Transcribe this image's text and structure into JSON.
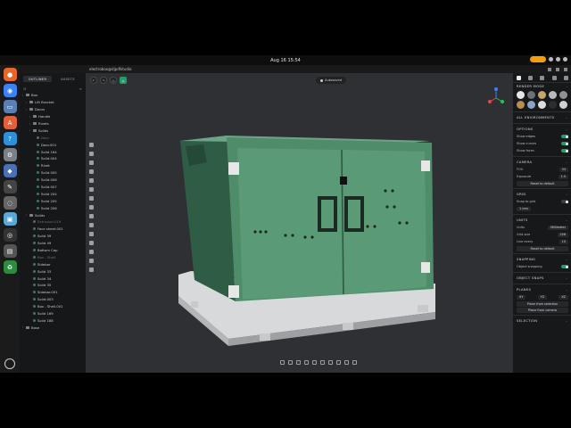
{
  "system": {
    "clock": "Aug 16  15:54"
  },
  "app": {
    "url": "electrobox@djpdfstudio",
    "saved_label": "Autosaved"
  },
  "outliner": {
    "tabs": [
      {
        "label": "OUTLINER"
      },
      {
        "label": "ASSETS"
      }
    ],
    "items": [
      {
        "label": "Box",
        "indent": 0,
        "kind": "folder",
        "dim": false
      },
      {
        "label": "Lift Bracket",
        "indent": 1,
        "kind": "folder",
        "dim": false
      },
      {
        "label": "Doors",
        "indent": 1,
        "kind": "folder",
        "dim": false
      },
      {
        "label": "Handle",
        "indent": 2,
        "kind": "folder",
        "dim": false
      },
      {
        "label": "Rivets",
        "indent": 2,
        "kind": "folder",
        "dim": false
      },
      {
        "label": "Solids",
        "indent": 2,
        "kind": "folder",
        "dim": false
      },
      {
        "label": "Door",
        "indent": 3,
        "kind": "solid",
        "dim": true
      },
      {
        "label": "Door.001",
        "indent": 3,
        "kind": "solid",
        "dim": false
      },
      {
        "label": "Solid 164",
        "indent": 3,
        "kind": "solid",
        "dim": false
      },
      {
        "label": "Solid.004",
        "indent": 3,
        "kind": "solid",
        "dim": false
      },
      {
        "label": "Rivet",
        "indent": 3,
        "kind": "solid",
        "dim": false
      },
      {
        "label": "Solid.005",
        "indent": 3,
        "kind": "solid",
        "dim": false
      },
      {
        "label": "Solid.006",
        "indent": 3,
        "kind": "solid",
        "dim": false
      },
      {
        "label": "Solid.007",
        "indent": 3,
        "kind": "solid",
        "dim": false
      },
      {
        "label": "Solid 204",
        "indent": 3,
        "kind": "solid",
        "dim": false
      },
      {
        "label": "Solid 205",
        "indent": 3,
        "kind": "solid",
        "dim": false
      },
      {
        "label": "Solid 206",
        "indent": 3,
        "kind": "solid",
        "dim": false
      },
      {
        "label": "Solids",
        "indent": 1,
        "kind": "folder",
        "dim": false
      },
      {
        "label": "Extrusion.019",
        "indent": 2,
        "kind": "solid",
        "dim": true
      },
      {
        "label": "Face sheet.001",
        "indent": 2,
        "kind": "solid",
        "dim": false
      },
      {
        "label": "Solid 39",
        "indent": 2,
        "kind": "solid",
        "dim": false
      },
      {
        "label": "Solid 49",
        "indent": 2,
        "kind": "solid",
        "dim": false
      },
      {
        "label": "Bottom Cap",
        "indent": 2,
        "kind": "solid",
        "dim": false
      },
      {
        "label": "Box - Shell",
        "indent": 2,
        "kind": "solid",
        "dim": true
      },
      {
        "label": "Sidebar",
        "indent": 2,
        "kind": "solid",
        "dim": false
      },
      {
        "label": "Solid 33",
        "indent": 2,
        "kind": "solid",
        "dim": false
      },
      {
        "label": "Solid 34",
        "indent": 2,
        "kind": "solid",
        "dim": false
      },
      {
        "label": "Solid 35",
        "indent": 2,
        "kind": "solid",
        "dim": false
      },
      {
        "label": "Sidebar.001",
        "indent": 2,
        "kind": "solid",
        "dim": false
      },
      {
        "label": "Solid.003",
        "indent": 2,
        "kind": "solid",
        "dim": false
      },
      {
        "label": "Box - Shell.001",
        "indent": 2,
        "kind": "solid",
        "dim": false
      },
      {
        "label": "Solid 169",
        "indent": 2,
        "kind": "solid",
        "dim": false
      },
      {
        "label": "Solid 188",
        "indent": 2,
        "kind": "solid",
        "dim": false
      },
      {
        "label": "Base",
        "indent": 0,
        "kind": "folder",
        "dim": false
      }
    ]
  },
  "panel": {
    "render_mode": "RENDER MODE",
    "all_environments": "ALL ENVIRONMENTS",
    "options": "OPTIONS",
    "show_edges": "Show edges",
    "show_curves": "Show curves",
    "show_faces": "Show faces",
    "camera": "CAMERA",
    "fov_label": "FOV",
    "fov_value": "33",
    "exposure_label": "Exposure",
    "exposure_value": "1.0",
    "reset_label": "Reset to default",
    "grid": "GRID",
    "snap_to_grid": "Snap to grid",
    "snap_value": "1 mm",
    "units": "UNITS",
    "units_label": "Units",
    "units_value": "Millimeter",
    "grid_size_label": "Grid size",
    "grid_size_value": "256",
    "line_every_label": "Line every",
    "line_every_value": "10",
    "snapping": "SNAPPING",
    "object_snapping": "Object snapping",
    "object_snaps": "OBJECT SNAPS",
    "planes": "PLANES",
    "plane_xy": "XY",
    "plane_yz": "YZ",
    "plane_xz": "XZ",
    "plane_from_selection": "Plane from selection",
    "plane_from_camera": "Plane from camera",
    "selection": "SELECTION"
  },
  "colors": {
    "accent": "#1f9d6b",
    "box_green": "#4f8d6a",
    "viewport_bg": "#2e3033"
  }
}
